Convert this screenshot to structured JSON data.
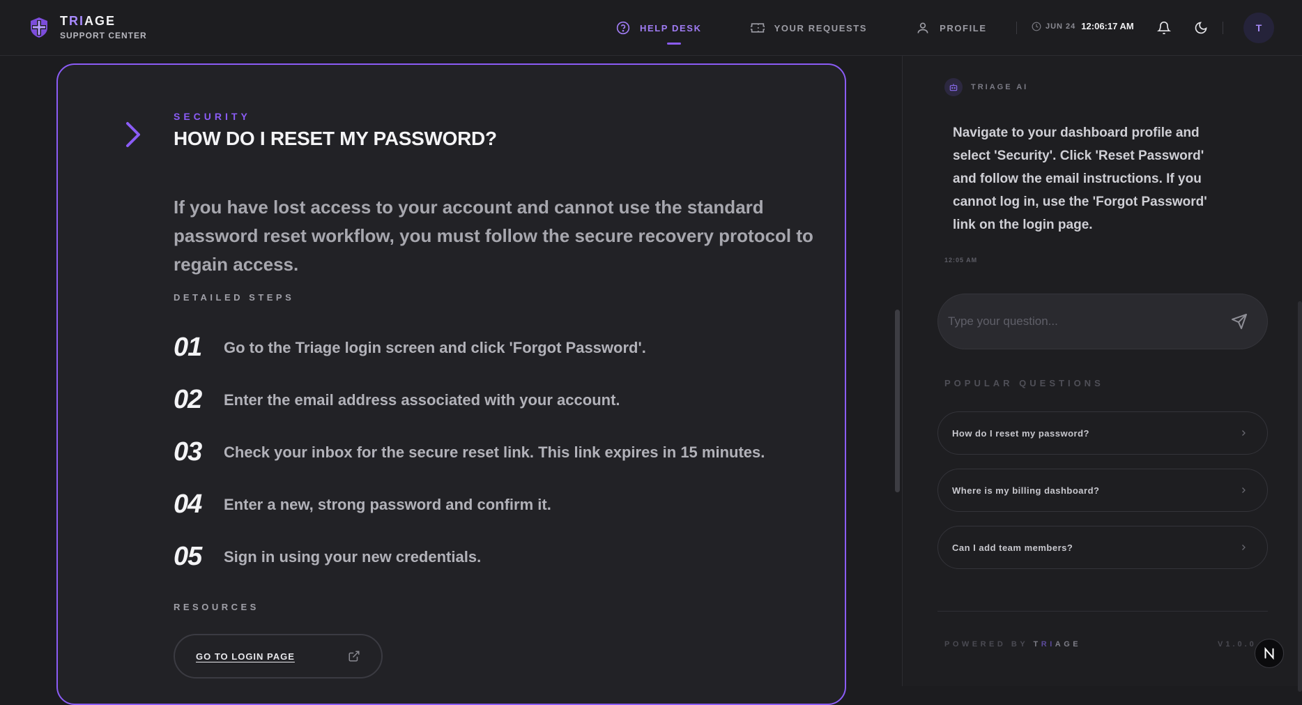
{
  "brand": {
    "title_prefix": "T",
    "title_highlight": "RI",
    "title_suffix": "AGE",
    "subtitle": "SUPPORT CENTER"
  },
  "nav": {
    "items": [
      {
        "label": "HELP DESK",
        "icon": "help-circle-icon",
        "active": true
      },
      {
        "label": "YOUR REQUESTS",
        "icon": "ticket-icon",
        "active": false
      },
      {
        "label": "PROFILE",
        "icon": "user-icon",
        "active": false
      }
    ]
  },
  "clock": {
    "date": "JUN 24",
    "time": "12:06:17 AM"
  },
  "avatar": {
    "initial": "T"
  },
  "article": {
    "category": "SECURITY",
    "title": "HOW DO I RESET MY PASSWORD?",
    "intro": "If you have lost access to your account and cannot use the standard password reset workflow, you must follow the secure recovery protocol to regain access.",
    "steps_label": "DETAILED STEPS",
    "steps": [
      {
        "num": "01",
        "text": "Go to the Triage login screen and click 'Forgot Password'."
      },
      {
        "num": "02",
        "text": "Enter the email address associated with your account."
      },
      {
        "num": "03",
        "text": "Check your inbox for the secure reset link. This link expires in 15 minutes."
      },
      {
        "num": "04",
        "text": "Enter a new, strong password and confirm it."
      },
      {
        "num": "05",
        "text": "Sign in using your new credentials."
      }
    ],
    "resources_label": "RESOURCES",
    "resource_button": "GO TO LOGIN PAGE"
  },
  "assistant": {
    "name": "TRIAGE AI",
    "message": "Navigate to your dashboard profile and select 'Security'. Click 'Reset Password' and follow the email instructions. If you cannot log in, use the 'Forgot Password' link on the login page.",
    "time": "12:05 AM",
    "input_placeholder": "Type your question...",
    "popular_label": "POPULAR QUESTIONS",
    "popular": [
      "How do I reset my password?",
      "Where is my billing dashboard?",
      "Can I add team members?"
    ],
    "powered_by": "POWERED BY",
    "powered_brand_prefix": "T",
    "powered_brand_highlight": "RI",
    "powered_brand_suffix": "AGE",
    "version": "V1.0.0"
  },
  "colors": {
    "accent": "#8b5cf6",
    "background": "#1c1c1f",
    "card": "#222226"
  }
}
